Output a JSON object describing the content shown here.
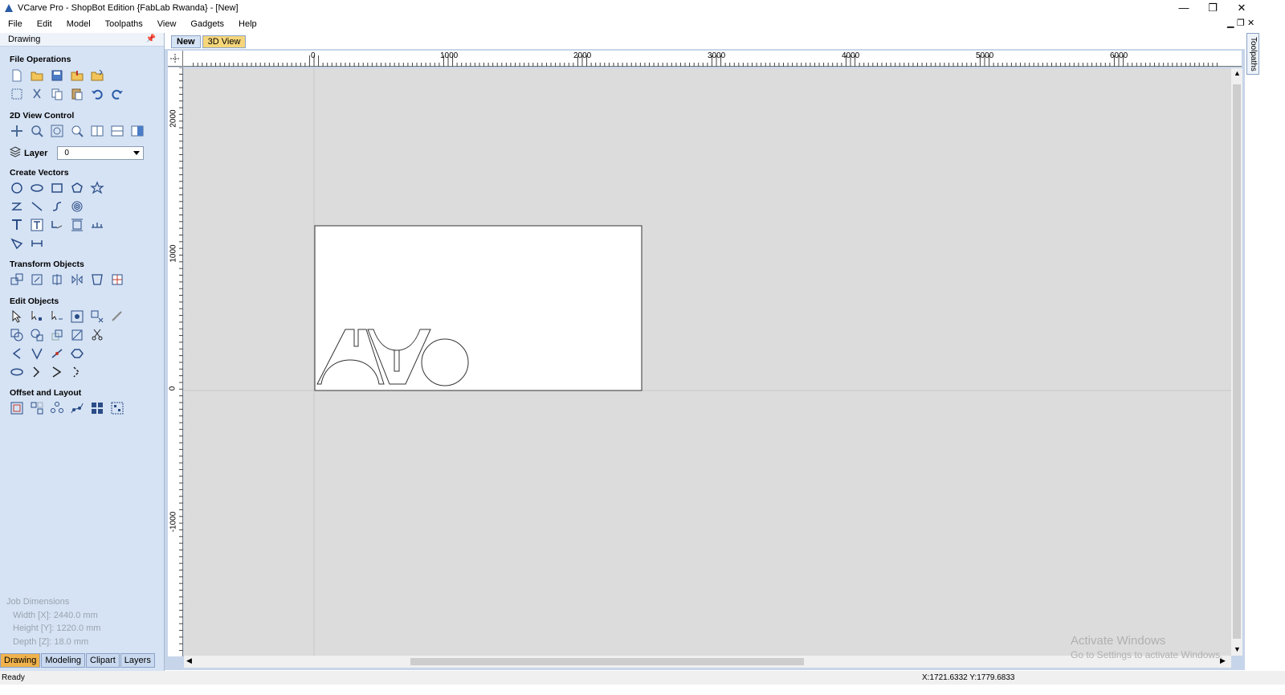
{
  "window": {
    "title": "VCarve Pro - ShopBot Edition {FabLab Rwanda} - [New]",
    "minimize": "—",
    "restore": "❐",
    "close": "✕"
  },
  "menu": {
    "items": [
      "File",
      "Edit",
      "Model",
      "Toolpaths",
      "View",
      "Gadgets",
      "Help"
    ]
  },
  "panel": {
    "title": "Drawing",
    "sections": {
      "file_operations": "File Operations",
      "view_control": "2D View Control",
      "create_vectors": "Create Vectors",
      "transform_objects": "Transform Objects",
      "edit_objects": "Edit Objects",
      "offset_layout": "Offset and Layout"
    },
    "layer": {
      "label": "Layer",
      "value": "0"
    }
  },
  "job_dimensions": {
    "title": "Job Dimensions",
    "width": "Width  [X]: 2440.0 mm",
    "height": "Height [Y]: 1220.0 mm",
    "depth": "Depth  [Z]: 18.0 mm"
  },
  "bottom_tabs": [
    "Drawing",
    "Modeling",
    "Clipart",
    "Layers"
  ],
  "doc_tabs": [
    "New",
    "3D View"
  ],
  "right_tab": "Toolpaths",
  "rulers": {
    "top": [
      "0",
      "1000",
      "2000",
      "3000",
      "4000",
      "5000",
      "6000"
    ],
    "left": [
      "2000",
      "1000",
      "0",
      "-1000"
    ]
  },
  "status": {
    "text": "Ready",
    "coords": "X:1721.6332 Y:1779.6833"
  },
  "watermark": {
    "line1": "Activate Windows",
    "line2": "Go to Settings to activate Windows."
  }
}
